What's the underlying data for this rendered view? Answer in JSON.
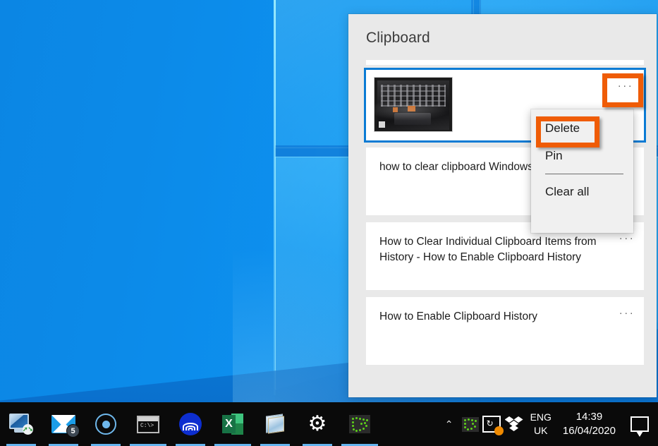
{
  "desktop": {
    "wallpaper_name": "windows-10-default-wallpaper",
    "accent_blue": "#0a7bd4",
    "panel_bg": "#e9e9e9",
    "annotation_color": "#ef5c06"
  },
  "clipboard": {
    "title": "Clipboard",
    "items": [
      {
        "type": "image",
        "thumb_name": "laptop-keyboard-photo",
        "text": "",
        "selected": true,
        "more_label": "···"
      },
      {
        "type": "text",
        "text": "how to clear clipboard Windows 10",
        "selected": false,
        "more_label": "···"
      },
      {
        "type": "text",
        "text": "How to Clear Individual Clipboard Items from History - How to Enable Clipboard History",
        "selected": false,
        "more_label": "···"
      },
      {
        "type": "text",
        "text": "How to Enable Clipboard History",
        "selected": false,
        "more_label": "···"
      }
    ]
  },
  "context_menu": {
    "items": [
      {
        "label": "Delete",
        "highlighted": true
      },
      {
        "label": "Pin",
        "highlighted": false
      },
      {
        "label": "Clear all",
        "highlighted": false
      }
    ]
  },
  "taskbar": {
    "apps": [
      {
        "name": "remote-desktop",
        "label": "Remote Desktop Connection",
        "badge": ""
      },
      {
        "name": "mail",
        "label": "Mail",
        "badge": "5"
      },
      {
        "name": "screen-recorder",
        "label": "Screen Recorder",
        "badge": ""
      },
      {
        "name": "command-prompt",
        "label": "Command Prompt",
        "badge": "",
        "prompt": "C:\\>"
      },
      {
        "name": "blue-app",
        "label": "Wireless App",
        "badge": ""
      },
      {
        "name": "excel",
        "label": "Microsoft Excel",
        "badge": "",
        "glyph": "X"
      },
      {
        "name": "paint",
        "label": "Paint",
        "badge": ""
      },
      {
        "name": "settings",
        "label": "Settings",
        "badge": "",
        "glyph": "⚙"
      },
      {
        "name": "green-dotted-app",
        "label": "Screen Capture Tool",
        "badge": ""
      }
    ],
    "tray": {
      "show_hidden_label": "⌃",
      "icons": [
        "green-dotted-tray-icon",
        "sync-icon",
        "dropbox-icon"
      ],
      "language": {
        "line1": "ENG",
        "line2": "UK"
      },
      "clock": {
        "time": "14:39",
        "date": "16/04/2020"
      },
      "action_center_label": "action-center-icon"
    }
  }
}
